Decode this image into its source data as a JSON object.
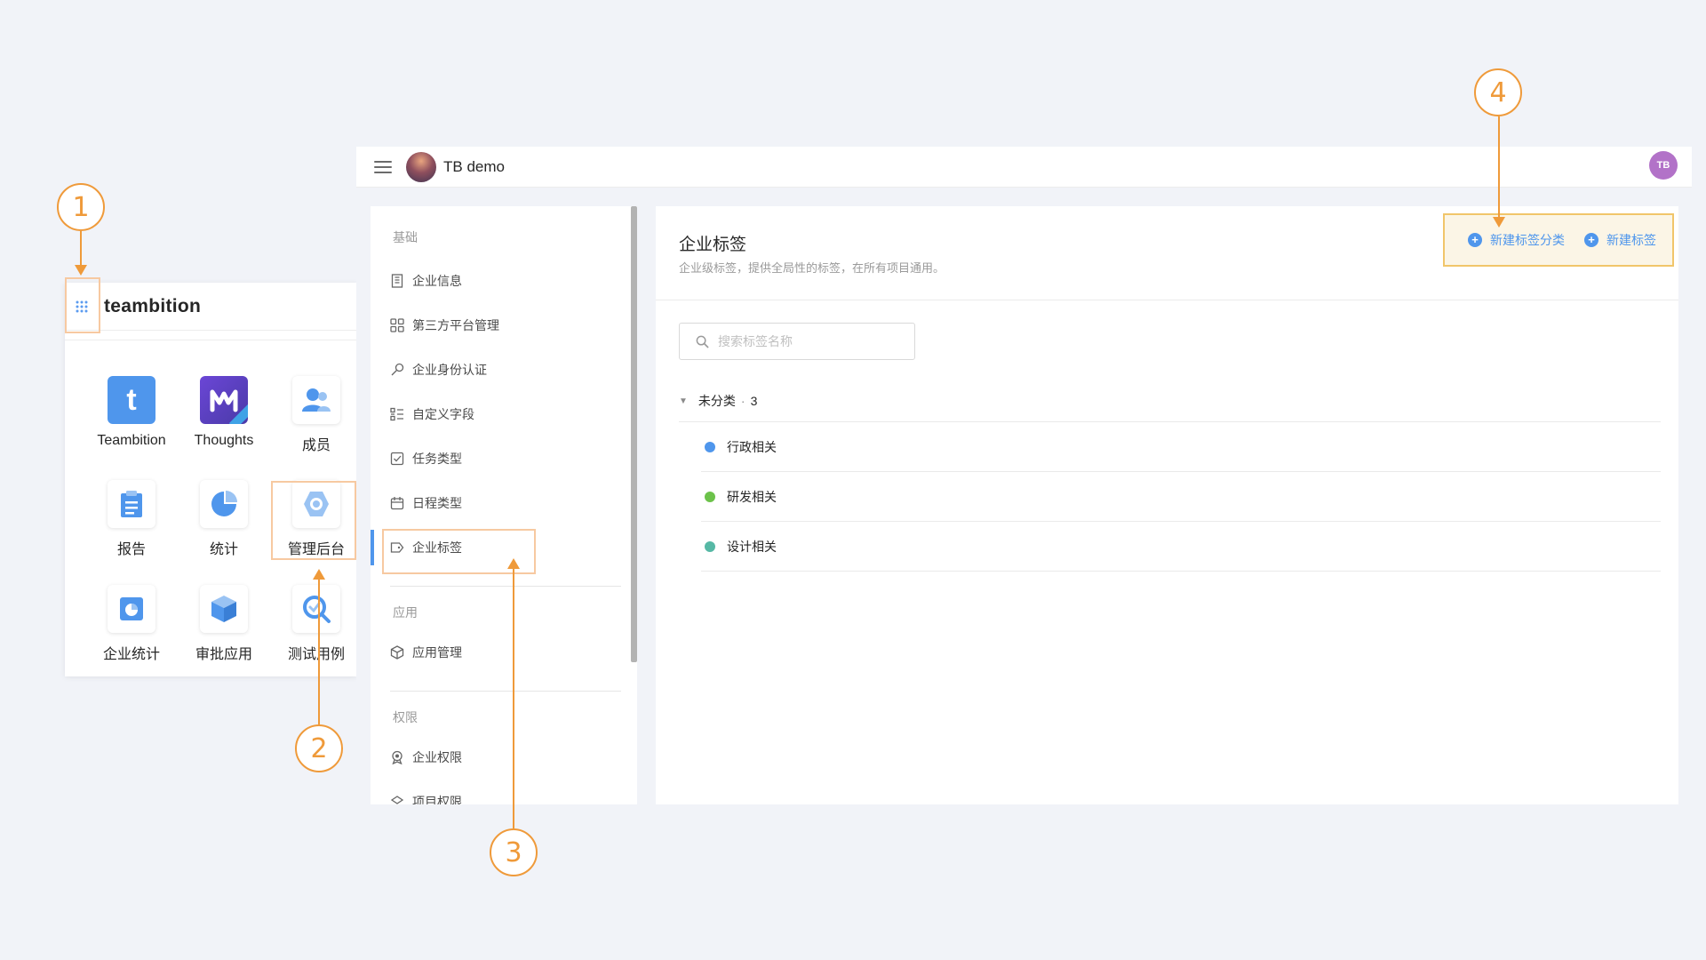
{
  "launcher": {
    "brand": "teambition",
    "apps": [
      {
        "label": "Teambition",
        "icon": "teambition-icon"
      },
      {
        "label": "Thoughts",
        "icon": "thoughts-icon"
      },
      {
        "label": "成员",
        "icon": "members-icon"
      },
      {
        "label": "报告",
        "icon": "report-icon"
      },
      {
        "label": "统计",
        "icon": "pie-chart-icon"
      },
      {
        "label": "管理后台",
        "icon": "admin-gear-icon"
      },
      {
        "label": "企业统计",
        "icon": "enterprise-stats-icon"
      },
      {
        "label": "审批应用",
        "icon": "approval-cube-icon"
      },
      {
        "label": "测试用例",
        "icon": "test-case-icon"
      }
    ]
  },
  "topbar": {
    "org_name": "TB demo",
    "user_initials": "TB"
  },
  "sidebar": {
    "groups": [
      {
        "title": "基础",
        "items": [
          {
            "label": "企业信息",
            "icon": "building-icon"
          },
          {
            "label": "第三方平台管理",
            "icon": "apps-grid-icon"
          },
          {
            "label": "企业身份认证",
            "icon": "key-icon"
          },
          {
            "label": "自定义字段",
            "icon": "fields-icon"
          },
          {
            "label": "任务类型",
            "icon": "checkbox-icon"
          },
          {
            "label": "日程类型",
            "icon": "calendar-icon"
          },
          {
            "label": "企业标签",
            "icon": "tag-icon"
          }
        ]
      },
      {
        "title": "应用",
        "items": [
          {
            "label": "应用管理",
            "icon": "box-icon"
          }
        ]
      },
      {
        "title": "权限",
        "items": [
          {
            "label": "企业权限",
            "icon": "badge-icon"
          },
          {
            "label": "项目权限",
            "icon": "shield-icon"
          }
        ]
      }
    ]
  },
  "content": {
    "title": "企业标签",
    "description": "企业级标签，提供全局性的标签，在所有项目通用。",
    "actions": {
      "new_category": "新建标签分类",
      "new_tag": "新建标签"
    },
    "search_placeholder": "搜索标签名称",
    "group": {
      "name": "未分类",
      "separator": "·",
      "count": "3"
    },
    "tags": [
      {
        "name": "行政相关",
        "color": "#4f96ec"
      },
      {
        "name": "研发相关",
        "color": "#6cc24a"
      },
      {
        "name": "设计相关",
        "color": "#56b8a5"
      }
    ]
  },
  "annotations": [
    "1",
    "2",
    "3",
    "4"
  ],
  "colors": {
    "accent": "#4f96ec",
    "annotation": "#ef9a3a"
  }
}
